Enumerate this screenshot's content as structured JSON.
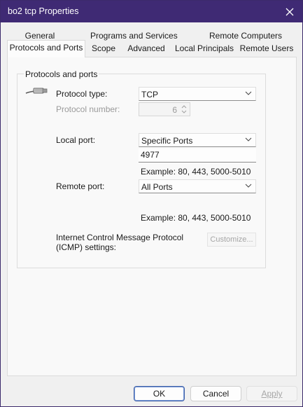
{
  "window": {
    "title": "bo2 tcp Properties",
    "close_icon": "close-icon",
    "titlebar_color": "#3f2a74"
  },
  "tabs": {
    "row1": [
      "General",
      "Programs and Services",
      "Remote Computers"
    ],
    "row2": [
      "Protocols and Ports",
      "Scope",
      "Advanced",
      "Local Principals",
      "Remote Users"
    ],
    "active": "Protocols and Ports"
  },
  "group": {
    "legend": "Protocols and ports",
    "icon": "network-cable-icon",
    "protocol_type_label": "Protocol type:",
    "protocol_type_value": "TCP",
    "protocol_number_label": "Protocol number:",
    "protocol_number_value": "6",
    "local_port_label": "Local port:",
    "local_port_mode": "Specific Ports",
    "local_port_value": "4977",
    "local_port_example": "Example: 80, 443, 5000-5010",
    "remote_port_label": "Remote port:",
    "remote_port_mode": "All Ports",
    "remote_port_example": "Example: 80, 443, 5000-5010",
    "icmp_label_line1": "Internet Control Message Protocol",
    "icmp_label_line2": "(ICMP) settings:",
    "customize_label": "Customize..."
  },
  "footer": {
    "ok": "OK",
    "cancel": "Cancel",
    "apply": "Apply"
  }
}
